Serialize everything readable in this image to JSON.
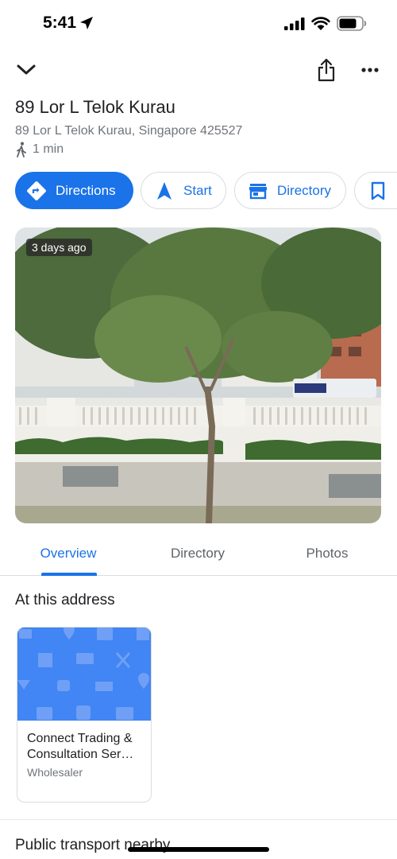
{
  "status_bar": {
    "time": "5:41"
  },
  "place": {
    "title": "89 Lor L Telok Kurau",
    "address": "89 Lor L Telok Kurau, Singapore 425527",
    "walk_time": "1 min"
  },
  "chips": {
    "directions": "Directions",
    "start": "Start",
    "directory": "Directory",
    "save": "S"
  },
  "photo": {
    "age_badge": "3 days ago"
  },
  "tabs": {
    "overview": "Overview",
    "directory": "Directory",
    "photos": "Photos",
    "active": "Overview"
  },
  "at_address": {
    "heading": "At this address",
    "cards": [
      {
        "title": "Connect Trading & Consultation Ser…",
        "category": "Wholesaler"
      }
    ]
  },
  "next_section": {
    "heading": "Public transport nearby"
  },
  "colors": {
    "accent": "#1a73e8",
    "card_banner": "#4285f4",
    "muted_text": "#70757a"
  },
  "icons": [
    "location-arrow-icon",
    "signal-icon",
    "wifi-icon",
    "battery-icon",
    "chevron-down-icon",
    "share-icon",
    "more-icon",
    "walk-icon",
    "directions-icon",
    "navigation-arrow-icon",
    "storefront-icon",
    "bookmark-icon"
  ]
}
